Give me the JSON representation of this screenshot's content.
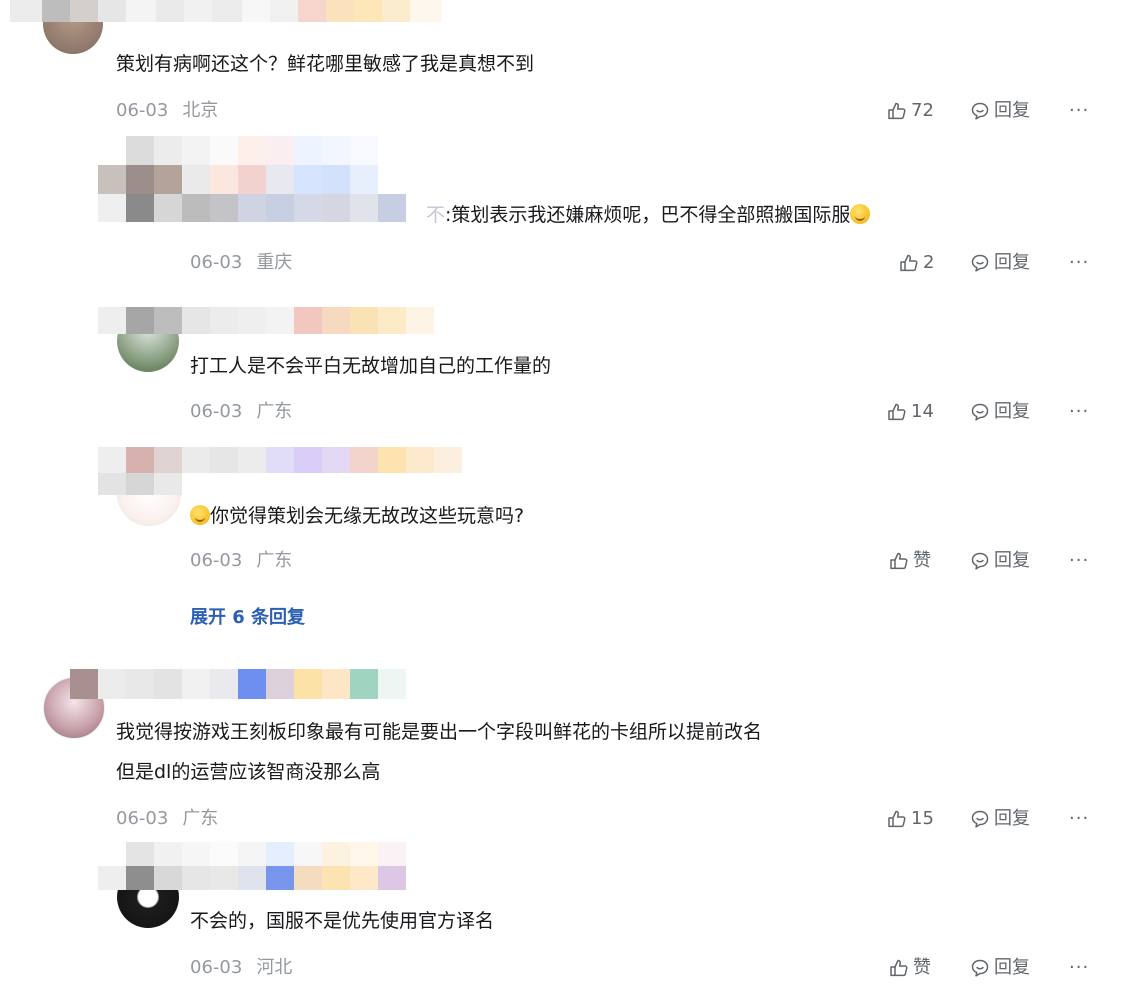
{
  "comments": [
    {
      "text": "策划有病啊还这个？鲜花哪里敏感了我是真想不到",
      "date": "06-03",
      "location": "北京",
      "likes": "72",
      "reply_label": "回复",
      "more": "···"
    },
    {
      "text_prefix": "不",
      "text": ":策划表示我还嫌麻烦呢，巴不得全部照搬国际服",
      "date": "06-03",
      "location": "重庆",
      "likes": "2",
      "reply_label": "回复",
      "more": "···"
    },
    {
      "text": "打工人是不会平白无故增加自己的工作量的",
      "date": "06-03",
      "location": "广东",
      "likes": "14",
      "reply_label": "回复",
      "more": "···"
    },
    {
      "text": "你觉得策划会无缘无故改这些玩意吗?",
      "date": "06-03",
      "location": "广东",
      "likes": "赞",
      "reply_label": "回复",
      "more": "···"
    },
    {
      "expand_label": "展开 6 条回复"
    },
    {
      "text_line1": "我觉得按游戏王刻板印象最有可能是要出一个字段叫鲜花的卡组所以提前改名",
      "text_line2": "但是dl的运营应该智商没那么高",
      "date": "06-03",
      "location": "广东",
      "likes": "15",
      "reply_label": "回复",
      "more": "···"
    },
    {
      "text": "不会的，国服不是优先使用官方译名",
      "date": "06-03",
      "location": "河北",
      "likes": "赞",
      "reply_label": "回复",
      "more": "···"
    }
  ],
  "icons": {
    "like": "thumbs-up-icon",
    "reply": "chat-bubble-icon",
    "emoji": "smiley-emoji-icon"
  },
  "colors": {
    "text": "#18191c",
    "meta": "#9499a0",
    "action": "#61666d",
    "expand": "#2b5fb3"
  }
}
